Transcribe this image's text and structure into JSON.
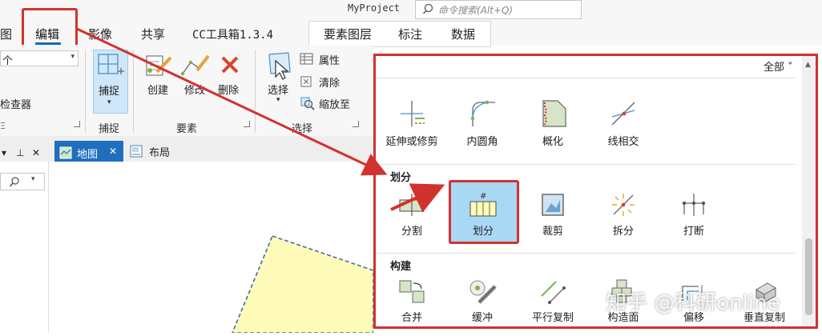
{
  "app": {
    "project_name": "MyProject",
    "search_placeholder": "命令搜索(Alt+Q)"
  },
  "tabs": {
    "cut_left": "图",
    "edit": "编辑",
    "imagery": "影像",
    "share": "共享",
    "cc_toolbox": "CC工具箱1.3.4",
    "feature_layer": "要素图层",
    "label": "标注",
    "data": "数据"
  },
  "ribbon": {
    "dropdown_value": "个",
    "inspector_text": "检查器",
    "snap": {
      "label": "捕捉",
      "group": "捕捉"
    },
    "features": {
      "create": "创建",
      "modify": "修改",
      "delete": "删除",
      "group": "要素"
    },
    "selection": {
      "select": "选择",
      "attributes": "属性",
      "clear": "清除",
      "zoom_to": "缩放至",
      "group": "选择"
    },
    "cut_group_label": "Ξ"
  },
  "panes": {
    "map_tab": "地图",
    "layout_tab": "布局",
    "pin_glyph": "⊥",
    "close_glyph": "✕"
  },
  "gallery": {
    "filter": "全部",
    "row1": [
      "延伸或修剪",
      "内圆角",
      "概化",
      "线相交"
    ],
    "section_divide": "划分",
    "divide_tools": [
      "分割",
      "划分",
      "裁剪",
      "拆分",
      "打断"
    ],
    "section_construct": "构建",
    "construct_tools": [
      "合并",
      "缓冲",
      "平行复制",
      "构造面",
      "偏移",
      "垂直复制"
    ]
  },
  "watermark": "知乎 @科研online",
  "colors": {
    "highlight_red": "#d2322d",
    "selected_blue": "#a9d8f5",
    "active_blue": "#0e6bb8",
    "polygon_fill": "#fffbb8"
  }
}
